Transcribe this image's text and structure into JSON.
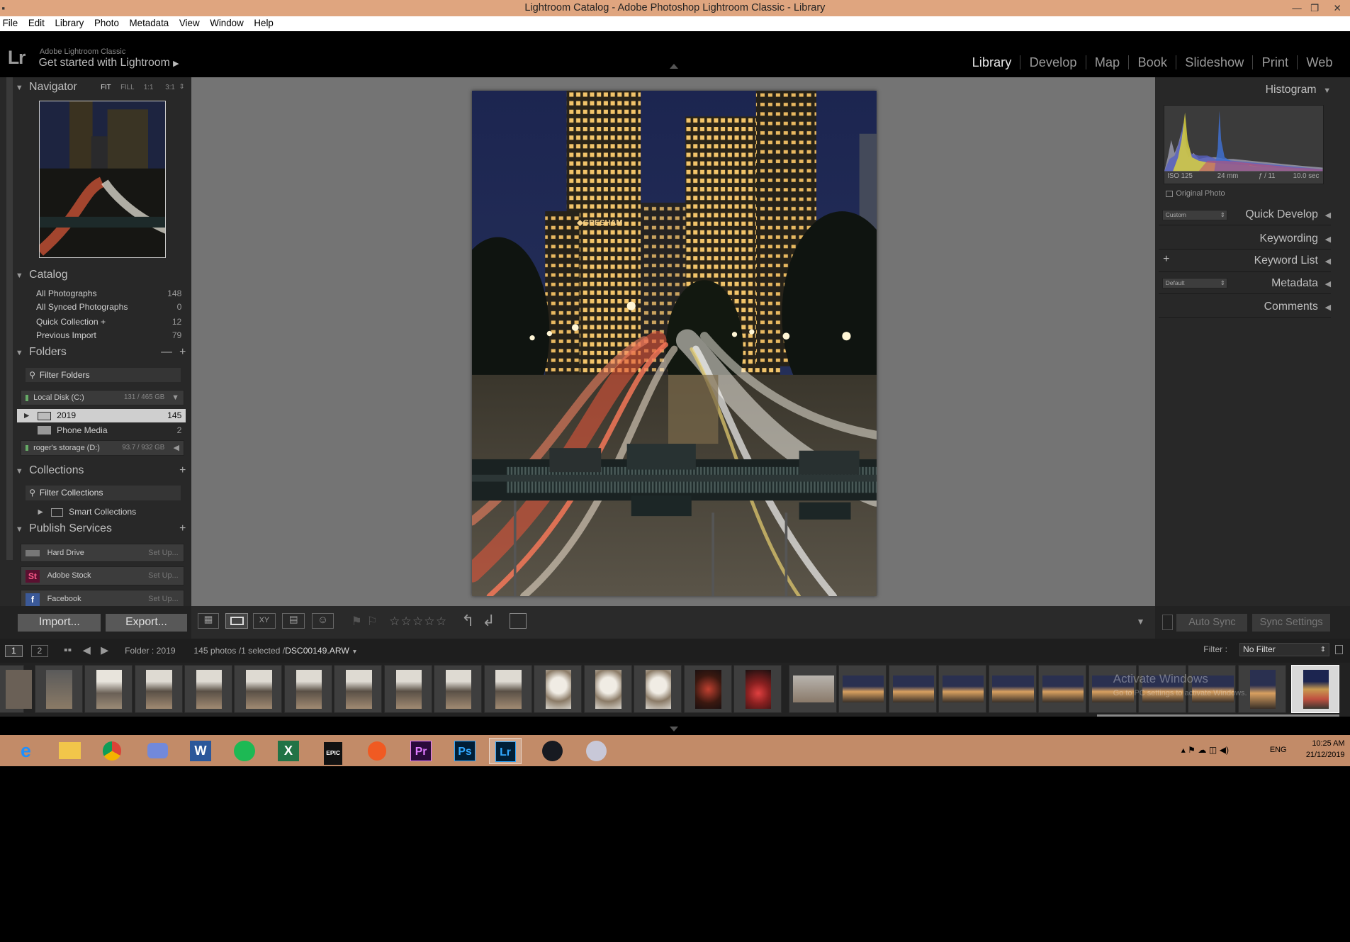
{
  "window": {
    "title": "Lightroom Catalog - Adobe Photoshop Lightroom Classic - Library"
  },
  "menu": [
    "File",
    "Edit",
    "Library",
    "Photo",
    "Metadata",
    "View",
    "Window",
    "Help"
  ],
  "identity": {
    "logo": "Lr",
    "small": "Adobe Lightroom Classic",
    "big": "Get started with Lightroom"
  },
  "modules": [
    "Library",
    "Develop",
    "Map",
    "Book",
    "Slideshow",
    "Print",
    "Web"
  ],
  "navigator": {
    "title": "Navigator",
    "zoom": [
      "FIT",
      "FILL",
      "1:1",
      "3:1"
    ]
  },
  "catalog": {
    "title": "Catalog",
    "items": [
      {
        "label": "All Photographs",
        "count": "148"
      },
      {
        "label": "All Synced Photographs",
        "count": "0"
      },
      {
        "label": "Quick Collection +",
        "count": "12"
      },
      {
        "label": "Previous Import",
        "count": "79"
      }
    ]
  },
  "folders": {
    "title": "Folders",
    "filter": "Filter Folders",
    "disk1": {
      "label": "Local Disk (C:)",
      "size": "131 / 465 GB"
    },
    "items": [
      {
        "label": "2019",
        "count": "145"
      },
      {
        "label": "Phone Media",
        "count": "2"
      }
    ],
    "disk2": {
      "label": "roger's storage (D:)",
      "size": "93.7 / 932 GB"
    }
  },
  "collections": {
    "title": "Collections",
    "filter": "Filter Collections",
    "smart": "Smart Collections"
  },
  "publish": {
    "title": "Publish Services",
    "items": [
      {
        "label": "Hard Drive",
        "setup": "Set Up..."
      },
      {
        "label": "Adobe Stock",
        "setup": "Set Up..."
      },
      {
        "label": "Facebook",
        "setup": "Set Up..."
      }
    ]
  },
  "buttons": {
    "import": "Import...",
    "export": "Export...",
    "autosync": "Auto Sync",
    "syncsettings": "Sync Settings"
  },
  "histogram": {
    "title": "Histogram",
    "iso": "ISO 125",
    "focal": "24 mm",
    "aperture": "ƒ / 11",
    "shutter": "10.0 sec",
    "original": "Original Photo"
  },
  "rightpanels": {
    "quickdevelop": "Quick Develop",
    "quickdevelop_preset": "Custom",
    "keywording": "Keywording",
    "keywordlist": "Keyword List",
    "metadata": "Metadata",
    "metadata_preset": "Default",
    "comments": "Comments"
  },
  "filmstripbar": {
    "page1": "1",
    "page2": "2",
    "folder": "Folder : 2019",
    "selection": "145 photos /1 selected /",
    "filename": "DSC00149.ARW",
    "filter_label": "Filter :",
    "filter_value": "No Filter"
  },
  "watermark": {
    "line1": "Activate Windows",
    "line2": "Go to PC settings to activate Windows."
  },
  "taskbar": {
    "lang": "ENG",
    "time": "10:25 AM",
    "date": "21/12/2019"
  }
}
